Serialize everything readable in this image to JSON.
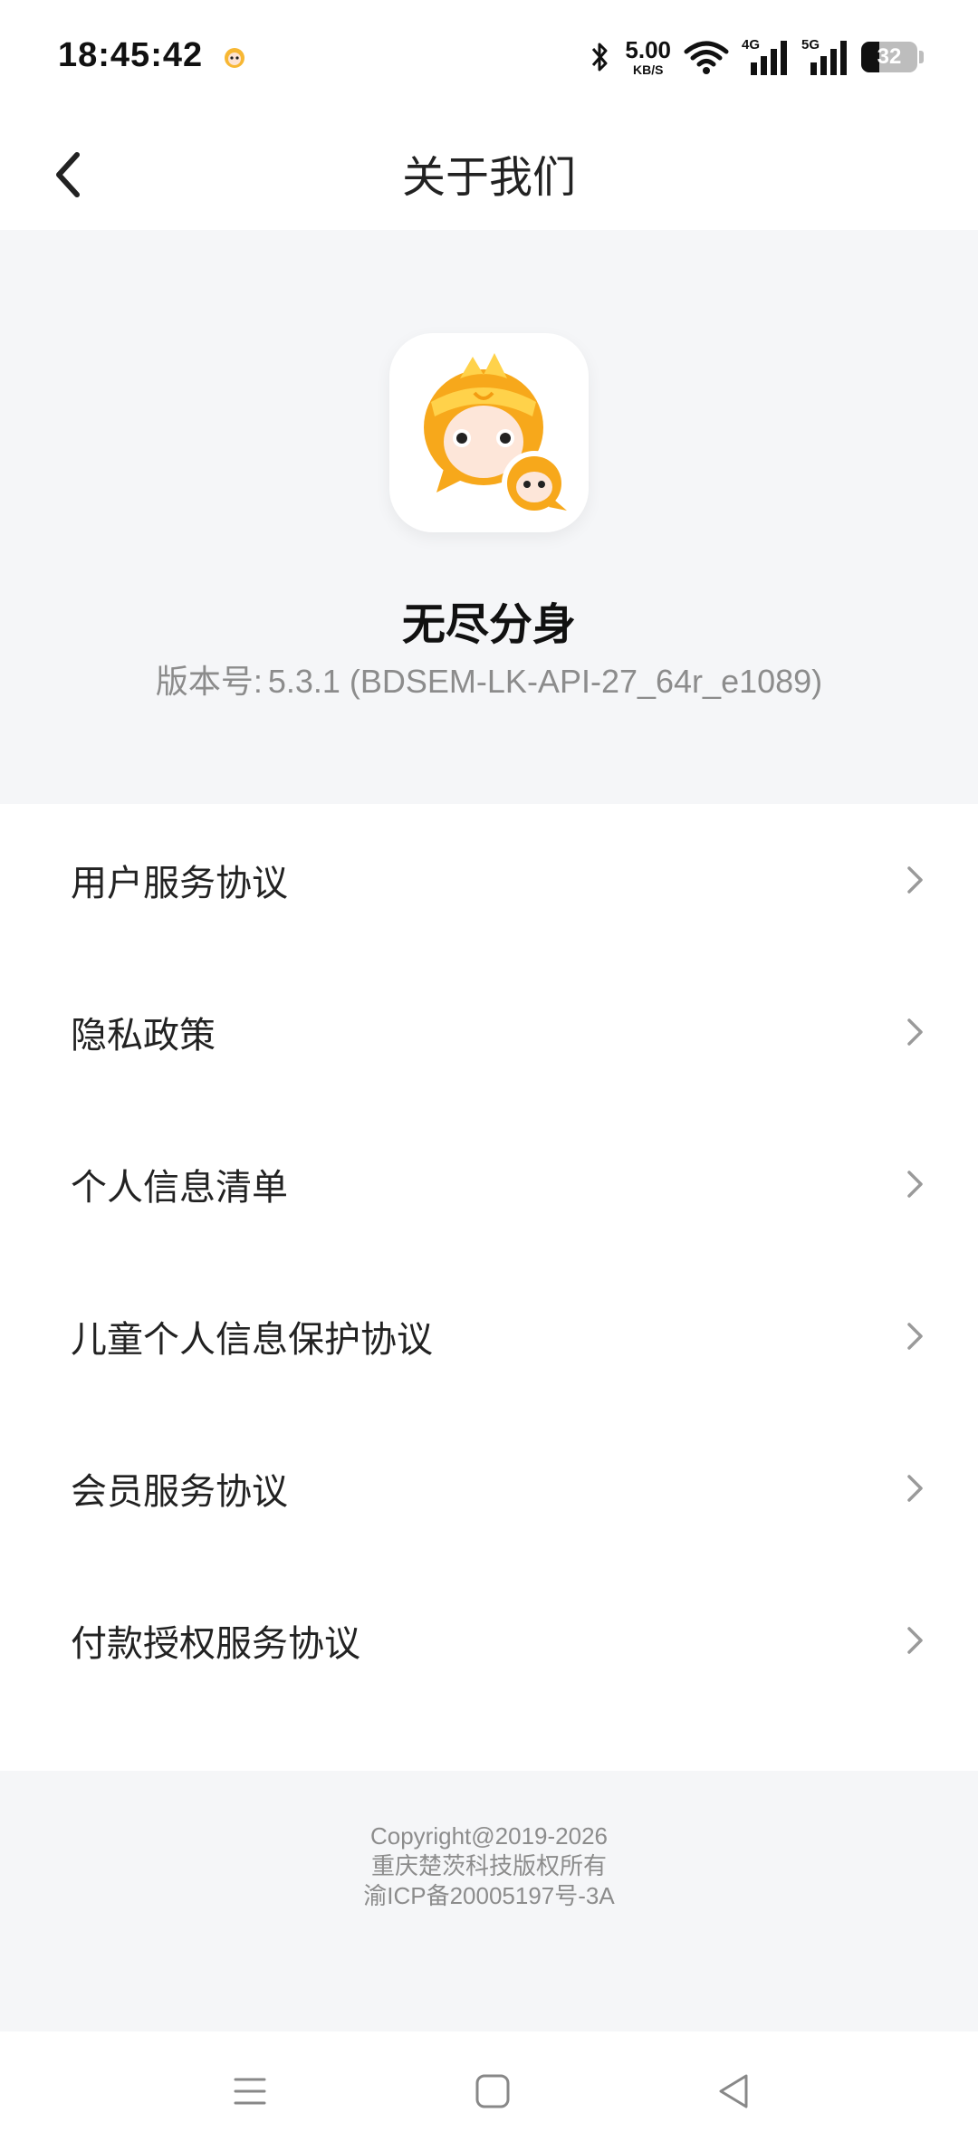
{
  "status_bar": {
    "time": "18:45:42",
    "net_speed_value": "5.00",
    "net_speed_unit": "KB/S",
    "signal_1_label": "4G",
    "signal_2_label": "5G",
    "battery_level": "32",
    "icons": [
      "app-notification-icon",
      "bluetooth-icon",
      "wifi-icon",
      "signal-4g-icon",
      "signal-5g-icon",
      "battery-icon"
    ]
  },
  "header": {
    "title": "关于我们",
    "back_icon": "chevron-left-icon"
  },
  "app_info": {
    "name": "无尽分身",
    "version_label": "版本号:",
    "version_value": "5.3.1 (BDSEM-LK-API-27_64r_e1089)",
    "icon": "app-logo-icon"
  },
  "menu": {
    "items": [
      {
        "label": "用户服务协议"
      },
      {
        "label": "隐私政策"
      },
      {
        "label": "个人信息清单"
      },
      {
        "label": "儿童个人信息保护协议"
      },
      {
        "label": "会员服务协议"
      },
      {
        "label": "付款授权服务协议"
      }
    ],
    "chevron_icon": "chevron-right-icon"
  },
  "footer": {
    "copyright": "Copyright@2019-2026",
    "company": "重庆楚茨科技版权所有",
    "icp": "渝ICP备20005197号-3A"
  },
  "nav_bar": {
    "icons": [
      "menu-icon",
      "home-icon",
      "back-triangle-icon"
    ]
  },
  "colors": {
    "background_gray": "#f5f6f8",
    "text_primary": "#222222",
    "text_secondary": "#8c8c8c",
    "logo_orange": "#f5a623"
  }
}
